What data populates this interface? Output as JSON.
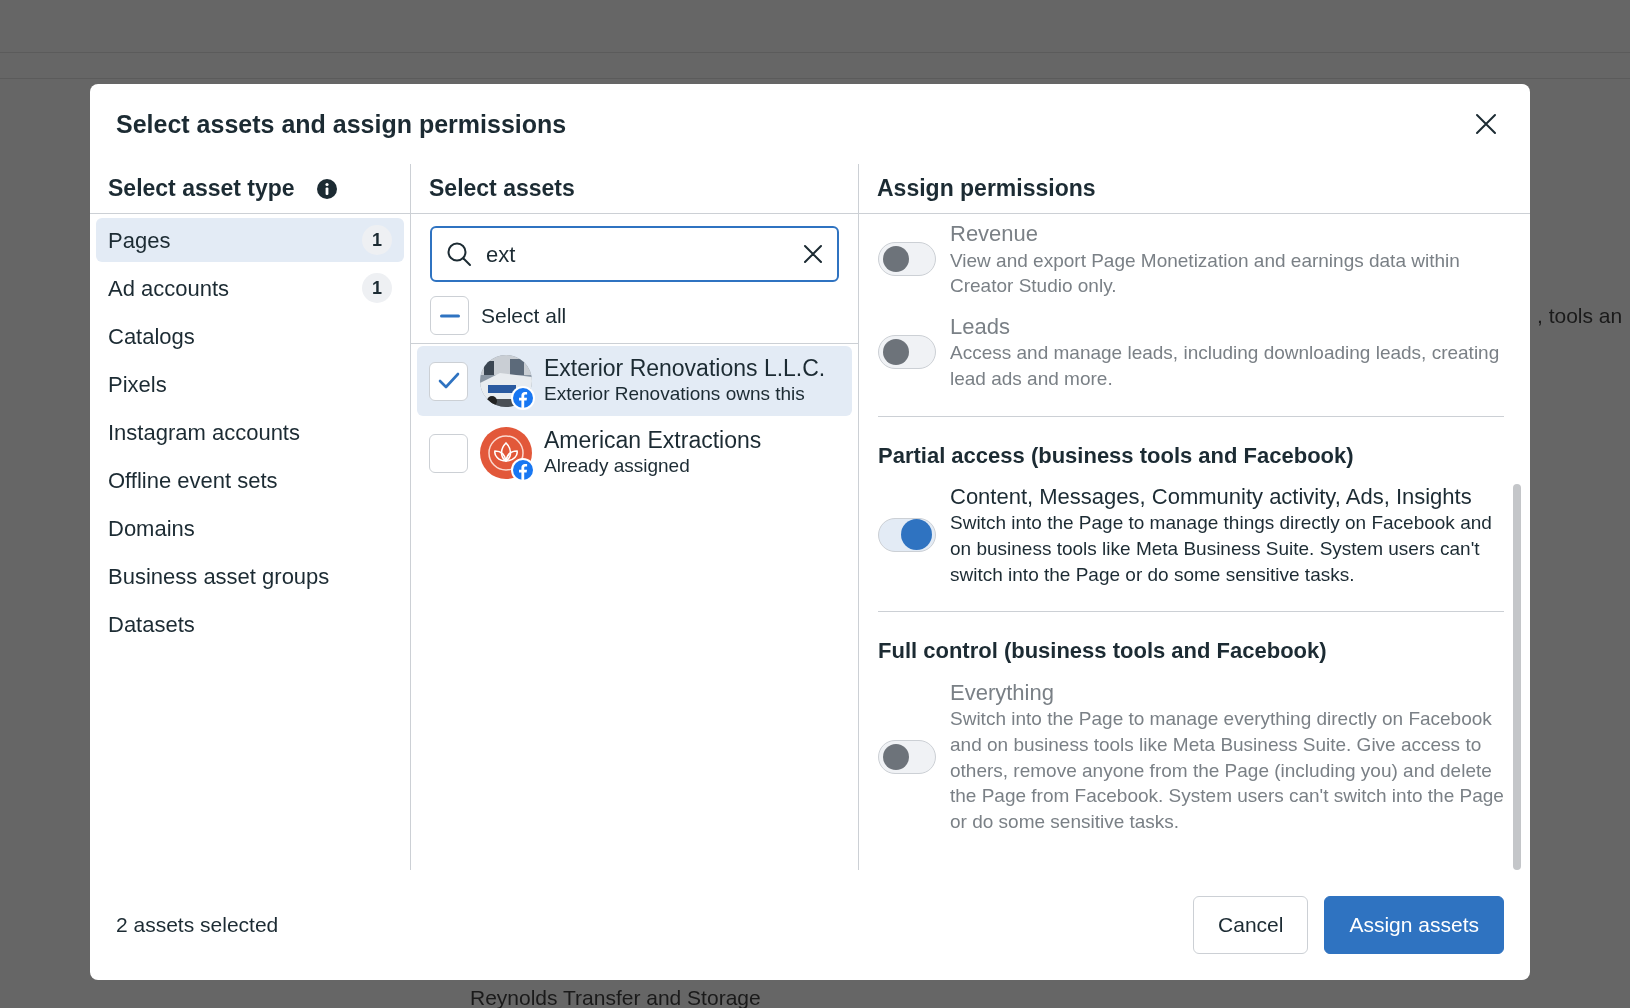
{
  "background": {
    "texts": [
      ", tools an",
      "Reynolds Transfer and Storage"
    ]
  },
  "dialog": {
    "title": "Select assets and assign permissions"
  },
  "asset_types": {
    "heading": "Select asset type",
    "items": [
      {
        "label": "Pages",
        "count": "1",
        "selected": true
      },
      {
        "label": "Ad accounts",
        "count": "1",
        "selected": false
      },
      {
        "label": "Catalogs",
        "selected": false
      },
      {
        "label": "Pixels",
        "selected": false
      },
      {
        "label": "Instagram accounts",
        "selected": false
      },
      {
        "label": "Offline event sets",
        "selected": false
      },
      {
        "label": "Domains",
        "selected": false
      },
      {
        "label": "Business asset groups",
        "selected": false
      },
      {
        "label": "Datasets",
        "selected": false
      }
    ]
  },
  "assets": {
    "heading": "Select assets",
    "search": {
      "value": "ext"
    },
    "select_all": {
      "label": "Select all",
      "indeterminate": true
    },
    "items": [
      {
        "name": "Exterior Renovations L.L.C.",
        "subtitle": "Exterior Renovations owns this",
        "checked": true,
        "selected": true,
        "kind": "picture"
      },
      {
        "name": "American Extractions",
        "subtitle": "Already assigned",
        "checked": false,
        "selected": false,
        "kind": "logo"
      }
    ]
  },
  "permissions": {
    "heading": "Assign permissions",
    "groups": [
      {
        "items": [
          {
            "title": "Revenue",
            "description": "View and export Page Monetization and earnings data within Creator Studio only.",
            "on": false,
            "disabled": true
          },
          {
            "title": "Leads",
            "description": "Access and manage leads, including downloading leads, creating lead ads and more.",
            "on": false,
            "disabled": true
          }
        ]
      },
      {
        "heading": "Partial access (business tools and Facebook)",
        "items": [
          {
            "title": "Content, Messages, Community activity, Ads, Insights",
            "description": "Switch into the Page to manage things directly on Facebook and on business tools like Meta Business Suite. System users can't switch into the Page or do some sensitive tasks.",
            "on": true,
            "disabled": false
          }
        ]
      },
      {
        "heading": "Full control (business tools and Facebook)",
        "items": [
          {
            "title": "Everything",
            "description": "Switch into the Page to manage everything directly on Facebook and on business tools like Meta Business Suite. Give access to others, remove anyone from the Page (including you) and delete the Page from Facebook. System users can't switch into the Page or do some sensitive tasks.",
            "on": false,
            "disabled": true
          }
        ]
      }
    ]
  },
  "footer": {
    "status": "2 assets selected",
    "buttons": [
      {
        "label": "Cancel",
        "kind": "secondary"
      },
      {
        "label": "Assign assets",
        "kind": "primary"
      }
    ]
  }
}
